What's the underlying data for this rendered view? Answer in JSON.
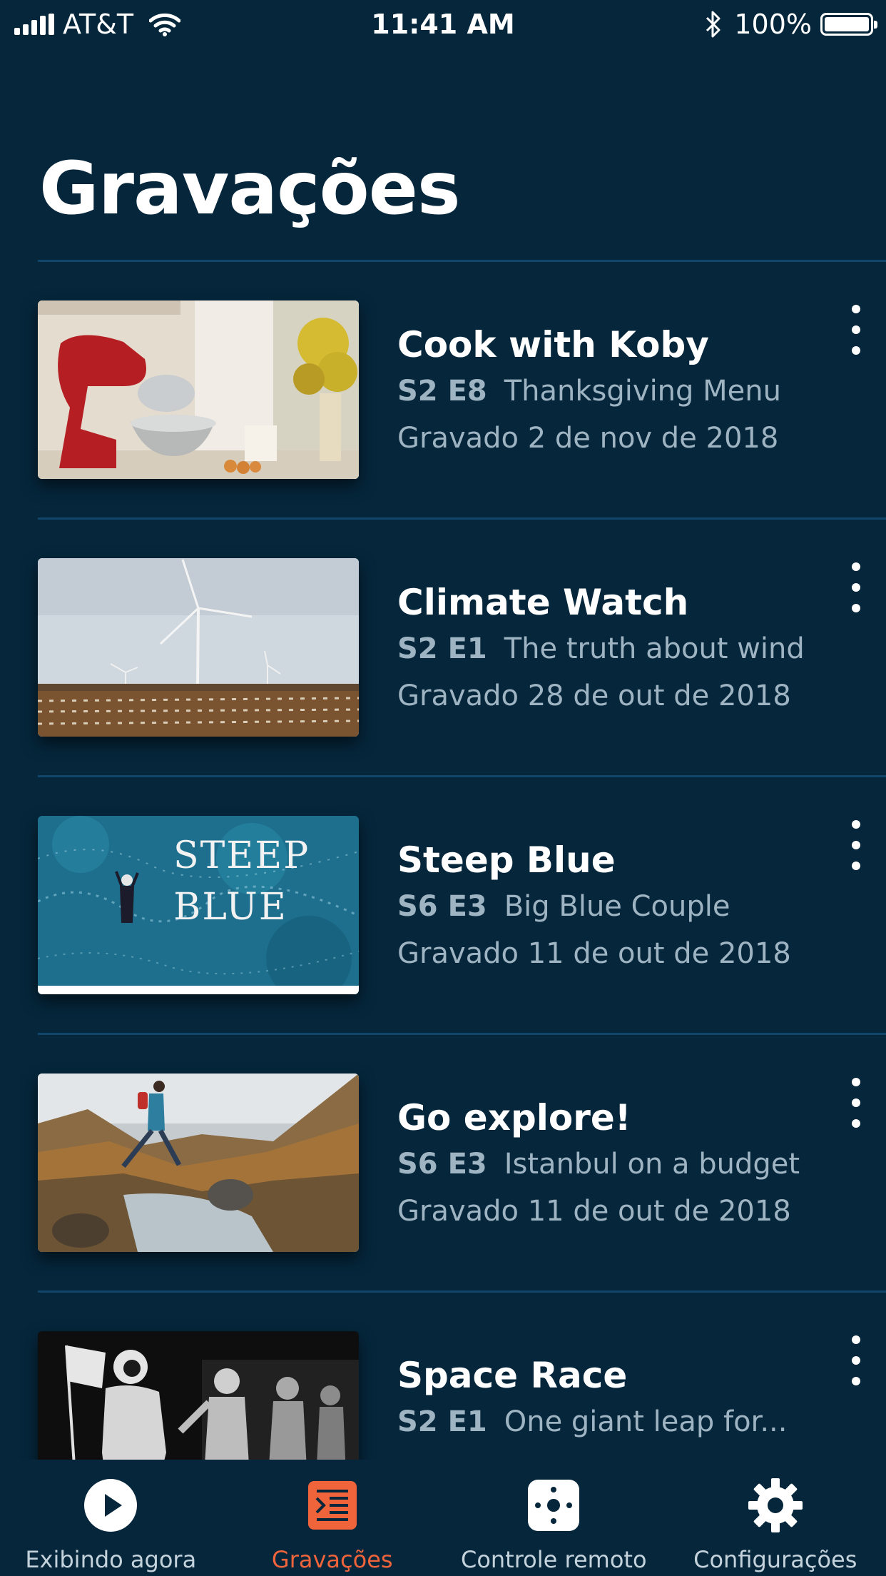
{
  "status_bar": {
    "carrier": "AT&T",
    "time": "11:41 AM",
    "battery": "100%",
    "battery_level": 1.0
  },
  "page": {
    "title": "Gravações"
  },
  "recordings": [
    {
      "title": "Cook with Koby",
      "episode": "S2 E8",
      "episode_title": "Thanksgiving Menu",
      "recorded": "Gravado 2 de nov de 2018",
      "thumbnail": "mixer-kitchen-image"
    },
    {
      "title": "Climate Watch",
      "episode": "S2 E1",
      "episode_title": "The truth about wind",
      "recorded": "Gravado 28 de out de 2018",
      "thumbnail": "wind-turbines-image"
    },
    {
      "title": "Steep Blue",
      "episode": "S6 E3",
      "episode_title": "Big Blue Couple",
      "recorded": "Gravado 11 de out de 2018",
      "thumbnail": "steep-blue-image",
      "thumbnail_text": [
        "STEEP",
        "BLUE"
      ]
    },
    {
      "title": "Go explore!",
      "episode": "S6 E3",
      "episode_title": "Istanbul on a budget",
      "recorded": "Gravado 11 de out de 2018",
      "thumbnail": "hiker-mountains-image"
    },
    {
      "title": "Space Race",
      "episode": "S2 E1",
      "episode_title": "One giant leap for...",
      "recorded": "",
      "thumbnail": "astronaut-figures-image"
    }
  ],
  "tab_bar": {
    "tabs": [
      {
        "label": "Exibindo agora",
        "icon": "play-icon",
        "active": false
      },
      {
        "label": "Gravações",
        "icon": "recordings-icon",
        "active": true
      },
      {
        "label": "Controle remoto",
        "icon": "remote-icon",
        "active": false
      },
      {
        "label": "Configurações",
        "icon": "gear-icon",
        "active": false
      }
    ],
    "active_color": "#f0643c"
  },
  "colors": {
    "background": "#05263b",
    "divider": "#11466a",
    "secondary_text": "#9fb4c2",
    "accent": "#f0643c"
  }
}
